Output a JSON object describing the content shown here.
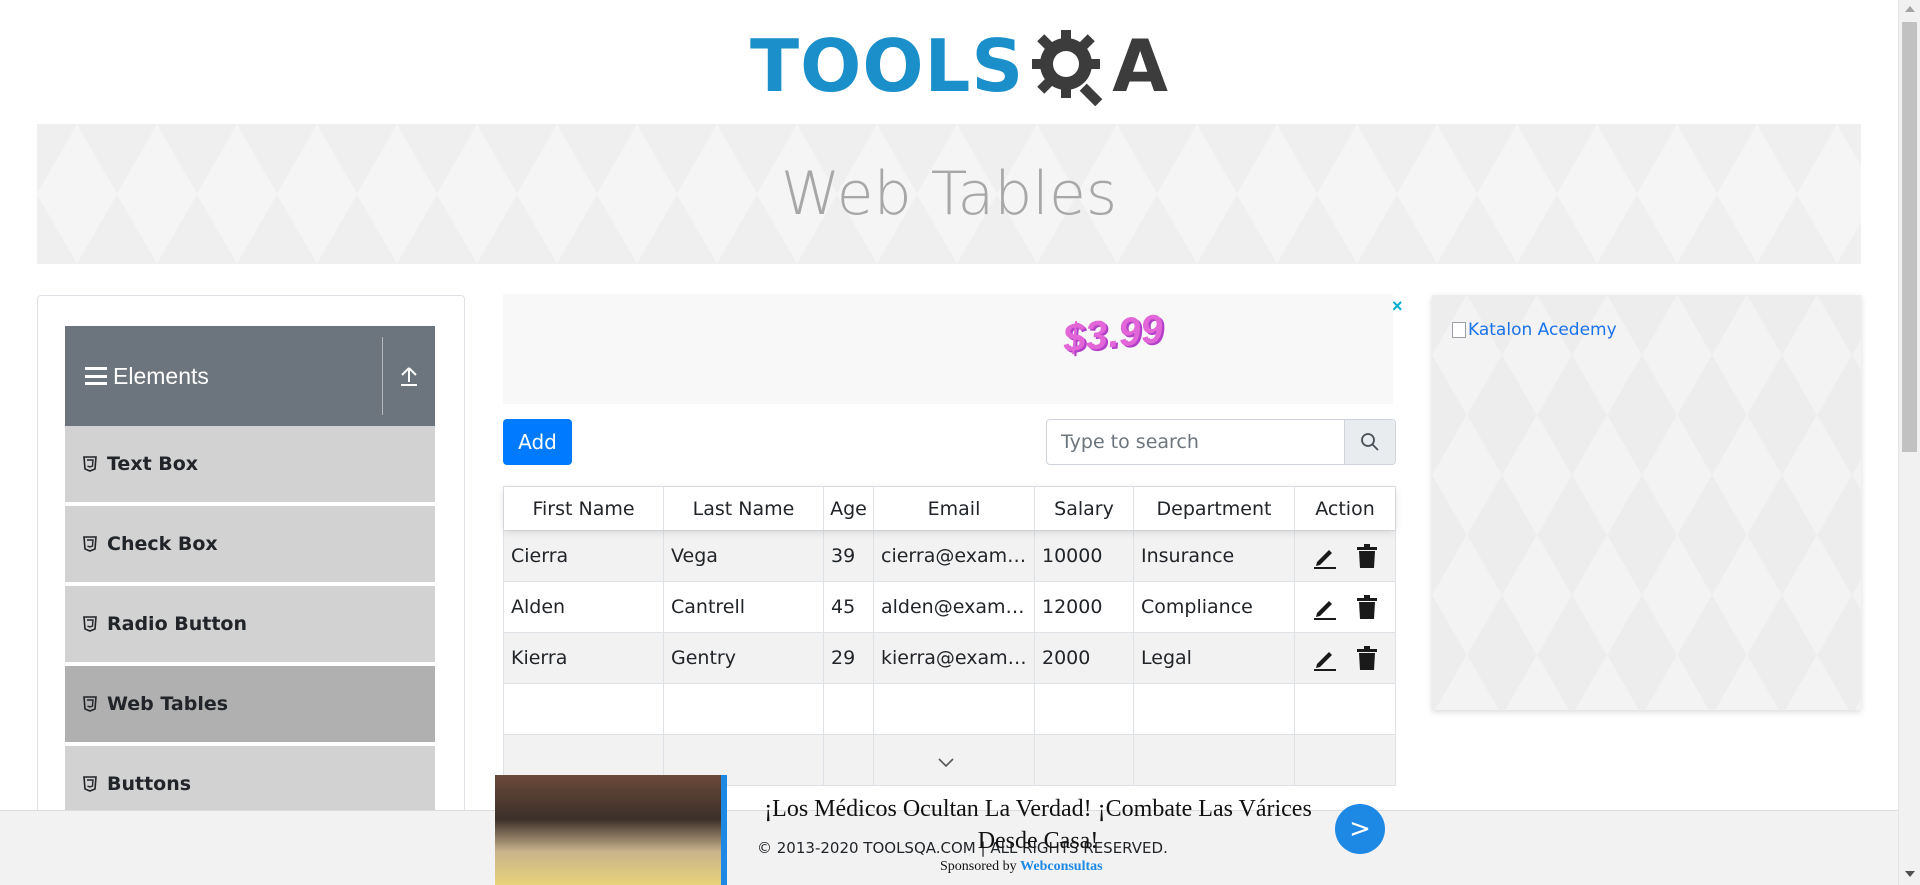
{
  "header": {
    "logo_part1": "TOOLS",
    "logo_part2": "A"
  },
  "banner": {
    "title": "Web Tables"
  },
  "sidebar": {
    "group_title": "Elements",
    "items": [
      {
        "label": "Text Box"
      },
      {
        "label": "Check Box"
      },
      {
        "label": "Radio Button"
      },
      {
        "label": "Web Tables",
        "active": true
      },
      {
        "label": "Buttons"
      }
    ]
  },
  "ad_top": {
    "price": "$3.99",
    "close": "×"
  },
  "controls": {
    "add_label": "Add",
    "search_placeholder": "Type to search"
  },
  "table": {
    "columns": [
      "First Name",
      "Last Name",
      "Age",
      "Email",
      "Salary",
      "Department",
      "Action"
    ],
    "rows": [
      [
        "Cierra",
        "Vega",
        "39",
        "cierra@example.com",
        "10000",
        "Insurance"
      ],
      [
        "Alden",
        "Cantrell",
        "45",
        "alden@example.com",
        "12000",
        "Compliance"
      ],
      [
        "Kierra",
        "Gentry",
        "29",
        "kierra@example.com",
        "2000",
        "Legal"
      ]
    ]
  },
  "right_ad": {
    "alt_text": "Katalon Acedemy"
  },
  "footer": {
    "copyright": "© 2013-2020 TOOLSQA.COM | ALL RIGHTS RESERVED."
  },
  "bottom_ad": {
    "headline": "¡Los Médicos Ocultan La Verdad! ¡Combate Las Várices Desde Casa!",
    "sponsor_prefix": "Sponsored by",
    "sponsor_name": "Webconsultas",
    "go_label": ">"
  },
  "icons": {
    "menu": "hamburger-icon",
    "collapse": "arrow-up-icon",
    "item": "html5-icon",
    "search": "search-icon",
    "edit": "pencil-icon",
    "delete": "trash-icon",
    "expand": "chevron-down-icon"
  },
  "colors": {
    "brand_blue": "#1a8fc9",
    "primary": "#007bff",
    "sidebar_header": "#6c757d",
    "menu_item": "#d2d2d2",
    "menu_active": "#b0b0b0"
  }
}
